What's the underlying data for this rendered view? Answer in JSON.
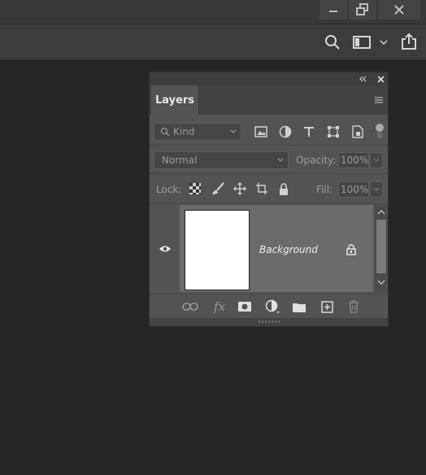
{
  "window": {
    "minimize_icon": "minimize-icon",
    "restore_icon": "restore-icon",
    "close_icon": "close-icon"
  },
  "options_bar": {
    "search_icon": "search-icon",
    "workspace_icon": "workspace-icon",
    "share_icon": "share-icon"
  },
  "layers_panel": {
    "tab_label": "Layers",
    "filter": {
      "kind_label": "Kind",
      "icons": [
        "image-filter-icon",
        "adjustment-filter-icon",
        "type-filter-icon",
        "shape-filter-icon",
        "smart-object-filter-icon"
      ]
    },
    "blend": {
      "mode": "Normal",
      "opacity_label": "Opacity:",
      "opacity_value": "100%"
    },
    "lock": {
      "lock_label": "Lock:",
      "fill_label": "Fill:",
      "fill_value": "100%"
    },
    "layers": [
      {
        "name": "Background",
        "visible": true,
        "locked": true
      }
    ],
    "bottom_icons": [
      "link-icon",
      "fx-icon",
      "mask-icon",
      "adjustment-icon",
      "folder-icon",
      "new-layer-icon",
      "trash-icon"
    ],
    "fx_text": "fx"
  },
  "colors": {
    "workspace": "#262626",
    "panel": "#535353",
    "selected_layer": "#6b6b6b"
  }
}
